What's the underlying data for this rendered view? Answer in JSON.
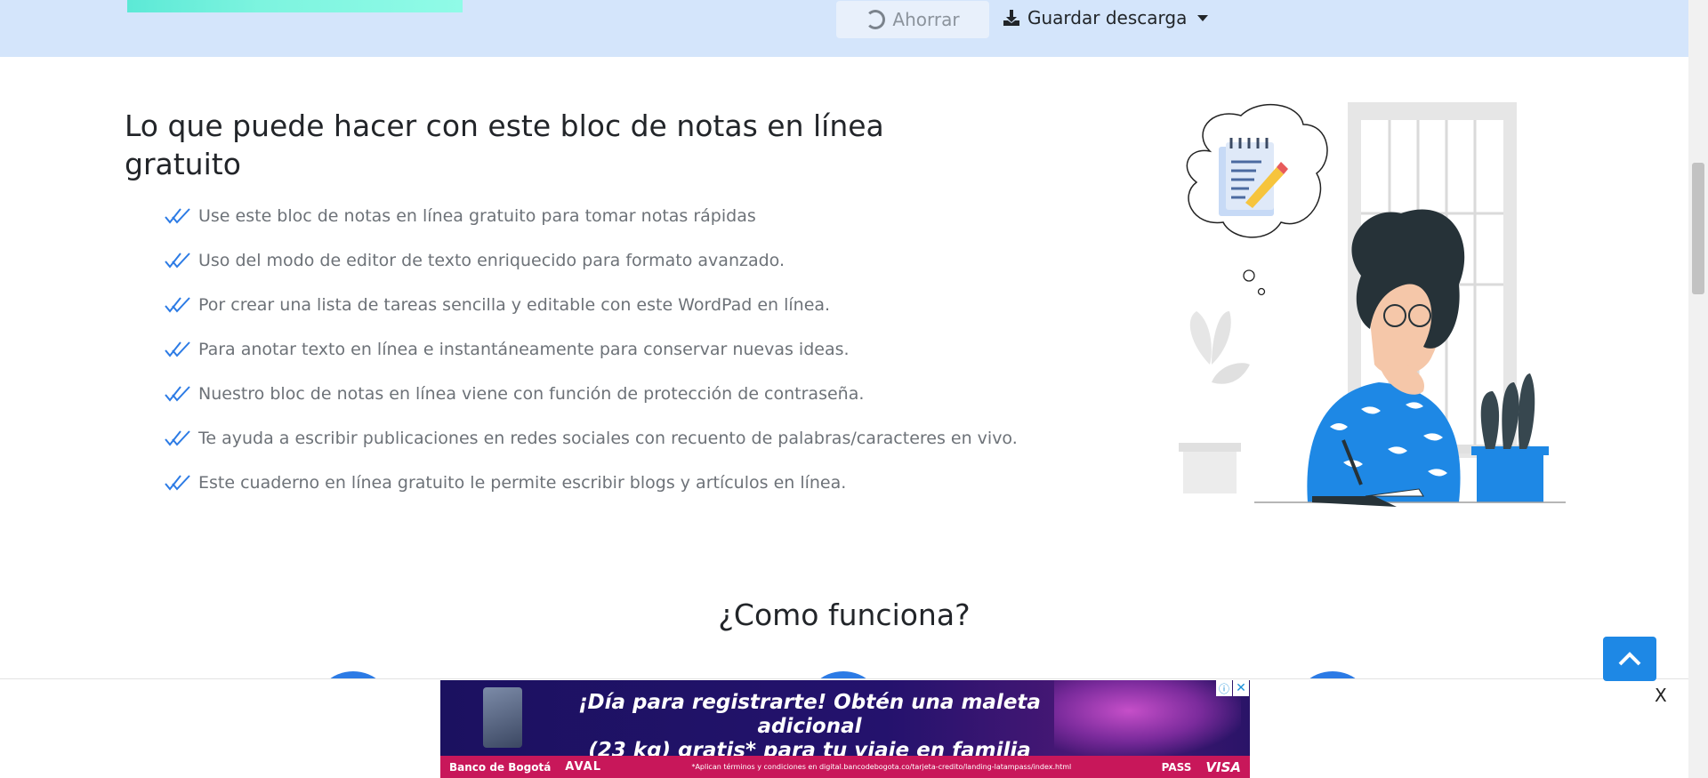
{
  "toolbar": {
    "save_label": "Ahorrar",
    "download_label": "Guardar descarga"
  },
  "main": {
    "title": "Lo que puede hacer con este bloc de notas en línea gratuito",
    "features": [
      "Use este bloc de notas en línea gratuito para tomar notas rápidas",
      "Uso del modo de editor de texto enriquecido para formato avanzado.",
      "Por crear una lista de tareas sencilla y editable con este WordPad en línea.",
      "Para anotar texto en línea e instantáneamente para conservar nuevas ideas.",
      "Nuestro bloc de notas en línea viene con función de protección de contraseña.",
      "Te ayuda a escribir publicaciones en redes sociales con recuento de palabras/caracteres en vivo.",
      "Este cuaderno en línea gratuito le permite escribir blogs y artículos en línea."
    ],
    "how_title": "¿Como funciona?"
  },
  "ad": {
    "headline_1": "¡Día para registrarte! Obtén una maleta adicional",
    "headline_2": "(23 kg) gratis* para tu viaje en familia",
    "bank": "Banco de Bogotá",
    "aval": "AVAL",
    "legal": "*Aplican términos y condiciones en digital.bancodebogota.co/tarjeta-credito/landing-latampass/index.html",
    "pass": "PASS",
    "visa": "VISA",
    "close_label": "X"
  },
  "colors": {
    "accent": "#1e88e5",
    "toolbar_bg": "#d4e5fb",
    "check": "#2c7be5"
  }
}
